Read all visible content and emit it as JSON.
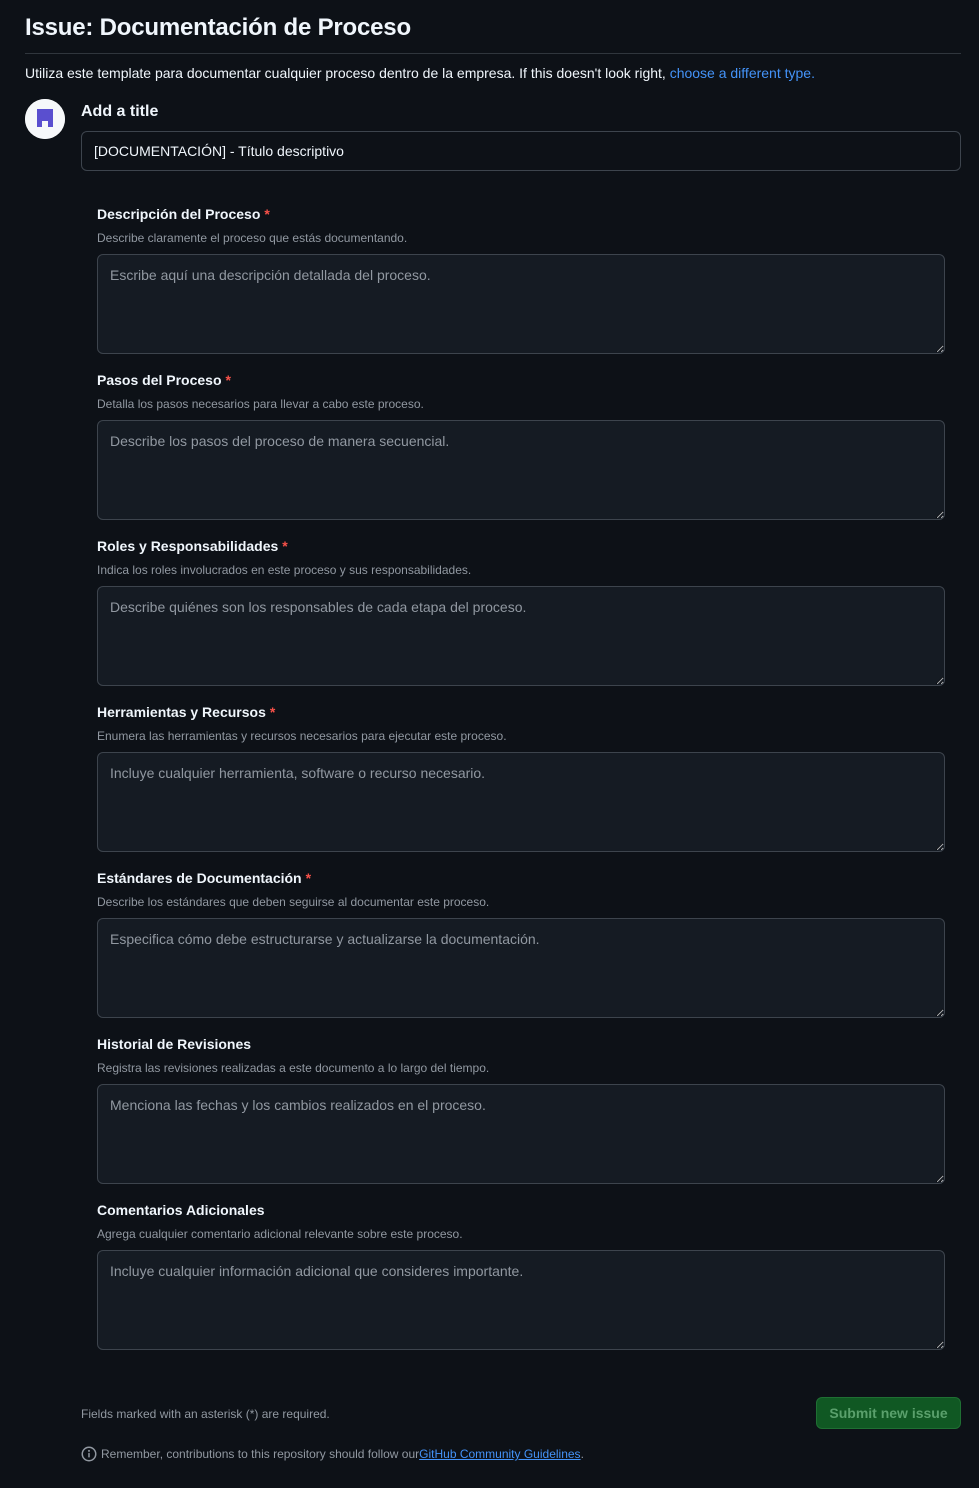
{
  "page": {
    "title": "Issue: Documentación de Proceso",
    "intro_text": "Utiliza este template para documentar cualquier proceso dentro de la empresa. If this doesn't look right, ",
    "intro_link": "choose a different type."
  },
  "title_field": {
    "label": "Add a title",
    "value": "[DOCUMENTACIÓN] - Título descriptivo"
  },
  "fields": [
    {
      "label": "Descripción del Proceso",
      "required": true,
      "description": "Describe claramente el proceso que estás documentando.",
      "placeholder": "Escribe aquí una descripción detallada del proceso."
    },
    {
      "label": "Pasos del Proceso",
      "required": true,
      "description": "Detalla los pasos necesarios para llevar a cabo este proceso.",
      "placeholder": "Describe los pasos del proceso de manera secuencial."
    },
    {
      "label": "Roles y Responsabilidades",
      "required": true,
      "description": "Indica los roles involucrados en este proceso y sus responsabilidades.",
      "placeholder": "Describe quiénes son los responsables de cada etapa del proceso."
    },
    {
      "label": "Herramientas y Recursos",
      "required": true,
      "description": "Enumera las herramientas y recursos necesarios para ejecutar este proceso.",
      "placeholder": "Incluye cualquier herramienta, software o recurso necesario."
    },
    {
      "label": "Estándares de Documentación",
      "required": true,
      "description": "Describe los estándares que deben seguirse al documentar este proceso.",
      "placeholder": "Especifica cómo debe estructurarse y actualizarse la documentación."
    },
    {
      "label": "Historial de Revisiones",
      "required": false,
      "description": "Registra las revisiones realizadas a este documento a lo largo del tiempo.",
      "placeholder": "Menciona las fechas y los cambios realizados en el proceso."
    },
    {
      "label": "Comentarios Adicionales",
      "required": false,
      "description": "Agrega cualquier comentario adicional relevante sobre este proceso.",
      "placeholder": "Incluye cualquier información adicional que consideres importante."
    }
  ],
  "required_mark": "*",
  "footer": {
    "required_note": "Fields marked with an asterisk (*) are required.",
    "submit_label": "Submit new issue",
    "guidelines_prefix": "Remember, contributions to this repository should follow our ",
    "guidelines_link": "GitHub Community Guidelines",
    "guidelines_suffix": "."
  },
  "colors": {
    "background": "#0d1117",
    "input_background": "#151b23",
    "border": "#3d444d",
    "link": "#4493f8",
    "required": "#f85149",
    "submit_background": "#105823",
    "avatar_accent": "#5a4fcf"
  },
  "icons": {
    "avatar": "user-avatar-icon",
    "info": "info-icon"
  }
}
